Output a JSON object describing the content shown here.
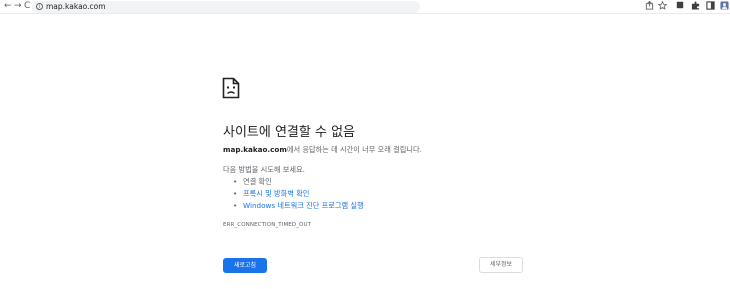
{
  "browser": {
    "back_glyph": "←",
    "forward_glyph": "→",
    "reload_glyph": "C",
    "info_glyph": "i",
    "url": "map.kakao.com",
    "tool_icons": [
      "share-icon",
      "bookmark-star-icon",
      "extension-icon",
      "puzzle-icon",
      "sidepanel-icon",
      "profile-icon"
    ]
  },
  "error": {
    "title": "사이트에 연결할 수 없음",
    "host": "map.kakao.com",
    "message_suffix": "에서 응답하는 데 시간이 너무 오래 걸립니다.",
    "try_heading": "다음 방법을 시도해 보세요.",
    "suggestions": {
      "check_connection": "연결 확인",
      "check_proxy": "프록시 및 방화벽 확인",
      "run_diagnostics": "Windows 네트워크 진단 프로그램 실행"
    },
    "code": "ERR_CONNECTION_TIMED_OUT"
  },
  "buttons": {
    "reload": "새로고침",
    "details": "세부정보"
  },
  "colors": {
    "accent": "#1a73e8",
    "text_primary": "#202124",
    "text_secondary": "#5f6368"
  }
}
